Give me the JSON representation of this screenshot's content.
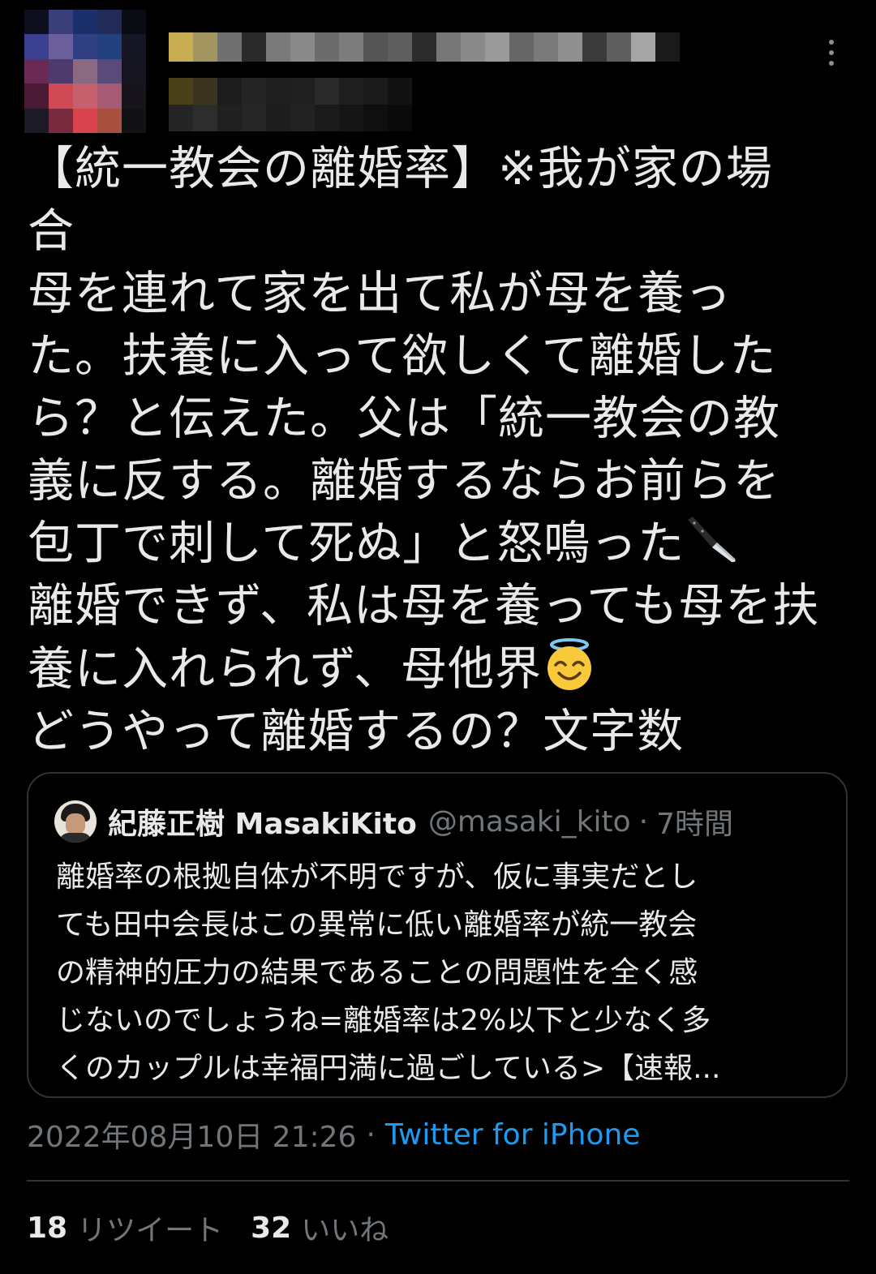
{
  "tweet": {
    "lines": [
      "【統一教会の離婚率】※我が家の場",
      "合",
      "母を連れて家を出て私が母を養っ",
      "た。扶養に入って欲しくて離婚した",
      "ら？と伝えた。父は「統一教会の教",
      "義に反する。離婚するならお前らを",
      "包丁で刺して死ぬ」と怒鳴った",
      "離婚できず、私は母を養っても母を扶",
      "養に入れられず、母他界",
      "どうやって離婚するの？文字数"
    ],
    "emoji": {
      "knife": "kitchen-knife-emoji",
      "halo": "smiling-face-with-halo-emoji"
    }
  },
  "quote": {
    "name": "紀藤正樹 MasakiKito",
    "handle": "@masaki_kito",
    "separator": "·",
    "time": "7時間",
    "lines": [
      "離婚率の根拠自体が不明ですが、仮に事実だとし",
      "ても田中会長はこの異常に低い離婚率が統一教会",
      "の精神的圧力の結果であることの問題性を全く感",
      "じないのでしょうね=離婚率は2%以下と少なく多",
      "くのカップルは幸福円満に過ごしている>【速報..."
    ]
  },
  "meta": {
    "timestamp": "2022年08月10日 21:26",
    "separator": "·",
    "source": "Twitter for iPhone"
  },
  "stats": {
    "retweets_count": "18",
    "retweets_label": "リツイート",
    "likes_count": "32",
    "likes_label": "いいね"
  },
  "colors": {
    "background": "#000000",
    "text": "#e7e9ea",
    "secondary": "#71767b",
    "link": "#1d9bf0",
    "border": "#2f3336"
  },
  "icons": {
    "more": "more-vertical-icon"
  }
}
